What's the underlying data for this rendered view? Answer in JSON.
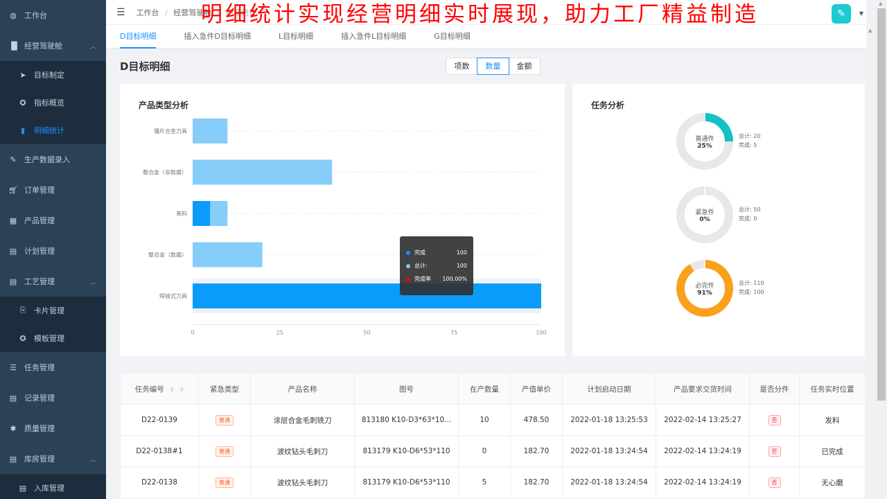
{
  "sidebar": {
    "items": [
      {
        "label": "工作台",
        "icon": "dashboard-icon"
      },
      {
        "label": "经营驾驶舱",
        "icon": "bar-chart-icon",
        "expanded": true,
        "children": [
          {
            "label": "目标制定",
            "icon": "paper-plane-icon"
          },
          {
            "label": "指标概览",
            "icon": "circle-icon"
          },
          {
            "label": "明细统计",
            "icon": "book-icon",
            "active": true
          }
        ]
      },
      {
        "label": "生产数据录入",
        "icon": "edit-icon"
      },
      {
        "label": "订单管理",
        "icon": "cart-icon"
      },
      {
        "label": "产品管理",
        "icon": "grid-icon"
      },
      {
        "label": "计划管理",
        "icon": "calendar-icon"
      },
      {
        "label": "工艺管理",
        "icon": "document-icon",
        "expanded": true,
        "children": [
          {
            "label": "卡片管理",
            "icon": "card-icon"
          },
          {
            "label": "模板管理",
            "icon": "circle-icon"
          }
        ]
      },
      {
        "label": "任务管理",
        "icon": "list-icon"
      },
      {
        "label": "记录管理",
        "icon": "record-icon"
      },
      {
        "label": "质量管理",
        "icon": "bug-icon"
      },
      {
        "label": "库房管理",
        "icon": "warehouse-icon",
        "expanded": true,
        "children": [
          {
            "label": "入库管理",
            "icon": "record-icon"
          }
        ]
      }
    ]
  },
  "topbar": {
    "breadcrumb": [
      "工作台",
      "经营驾驶舱",
      "明细统计"
    ],
    "separator": "/"
  },
  "banner": "明细统计实现经营明细实时展现，助力工厂精益制造",
  "tabs": [
    {
      "label": "D目标明细",
      "active": true
    },
    {
      "label": "插入急件D目标明细"
    },
    {
      "label": "L目标明细"
    },
    {
      "label": "插入急件L目标明细"
    },
    {
      "label": "G目标明细"
    }
  ],
  "page": {
    "title": "D目标明细",
    "segments": [
      {
        "label": "项数"
      },
      {
        "label": "数量",
        "active": true
      },
      {
        "label": "金额"
      }
    ]
  },
  "product_card": {
    "title": "产品类型分析"
  },
  "task_card": {
    "title": "任务分析",
    "donuts": [
      {
        "name": "普通件",
        "percent_label": "25%",
        "fraction": 0.25,
        "total_label": "总计: 20",
        "done_label": "完成: 5",
        "color": "#13c2c2"
      },
      {
        "name": "紧急件",
        "percent_label": "0%",
        "fraction": 0,
        "total_label": "总计: 50",
        "done_label": "完成: 0",
        "color": "#13c2c2"
      },
      {
        "name": "必完件",
        "percent_label": "91%",
        "fraction": 0.909,
        "total_label": "总计: 110",
        "done_label": "完成: 100",
        "color": "#faa11b"
      }
    ]
  },
  "tooltip": {
    "rows": [
      {
        "name": "完成",
        "value": "100",
        "color": "#1890ff"
      },
      {
        "name": "总计:",
        "value": "100",
        "color": "#7ec8f7"
      },
      {
        "name": "完成率",
        "value": "100.00%",
        "color": "#ff0000"
      }
    ]
  },
  "chart_data": {
    "type": "bar",
    "orientation": "horizontal",
    "title": "产品类型分析",
    "categories": [
      "镶片合金刀具",
      "整合金（非数磨）",
      "来料",
      "整合金（数磨）",
      "焊接式刀具"
    ],
    "series": [
      {
        "name": "总计",
        "values": [
          10,
          40,
          10,
          20,
          100
        ],
        "color": "#86cdf9"
      },
      {
        "name": "完成",
        "values": [
          0,
          0,
          5,
          0,
          100
        ],
        "color": "#0b9cf9"
      }
    ],
    "xlim": [
      0,
      100
    ],
    "xticks": [
      "0",
      "25",
      "50",
      "75",
      "100"
    ],
    "grid": "dashed horizontal",
    "highlighted_category": "焊接式刀具"
  },
  "table": {
    "columns": [
      "任务编号",
      "紧急类型",
      "产品名称",
      "图号",
      "在产数量",
      "产值单价",
      "计划启动日期",
      "产品要求交货时间",
      "是否分件",
      "任务实时位置"
    ],
    "rows": [
      [
        "D22-0139",
        "普通",
        "涂层合金毛刺铣刀",
        "813180 K10-D3*63*10...",
        "10",
        "478.50",
        "2022-01-18 13:25:53",
        "2022-02-14 13:25:27",
        "否",
        "发料"
      ],
      [
        "D22-0138#1",
        "普通",
        "波纹钻头毛刺刀",
        "813179 K10-D6*53*110",
        "0",
        "182.70",
        "2022-01-18 13:24:54",
        "2022-02-14 13:24:19",
        "否",
        "已完成"
      ],
      [
        "D22-0138",
        "普通",
        "波纹钻头毛刺刀",
        "813179 K10-D6*53*110",
        "5",
        "182.70",
        "2022-01-18 13:24:54",
        "2022-02-14 13:24:19",
        "否",
        "无心磨"
      ]
    ]
  }
}
